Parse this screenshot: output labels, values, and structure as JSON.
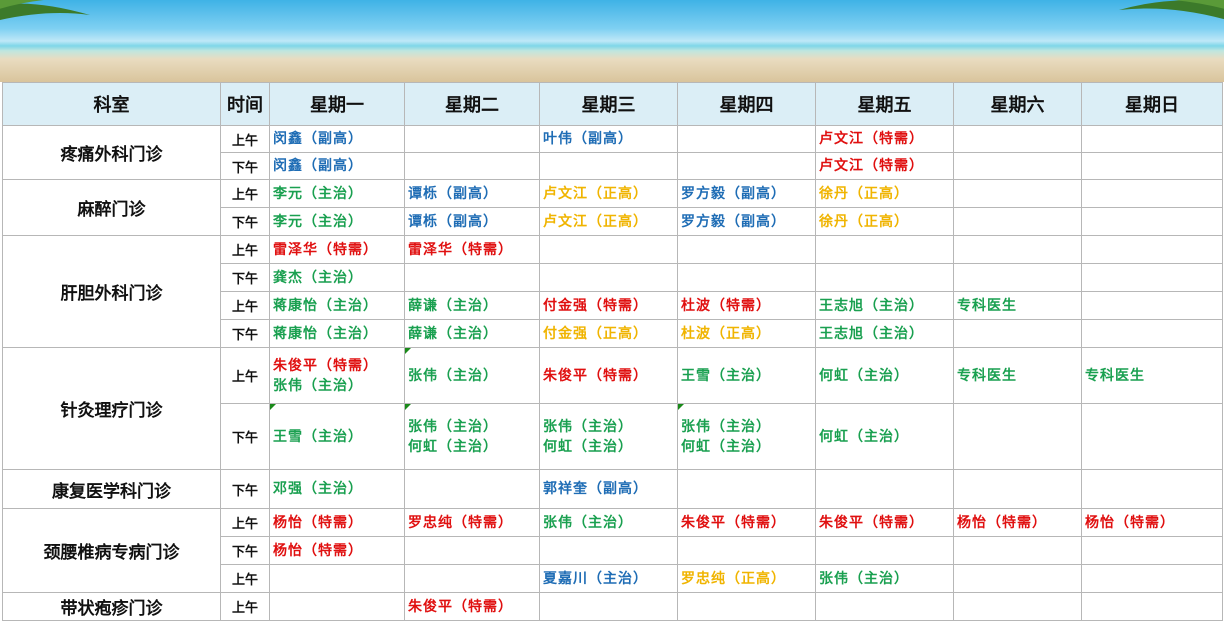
{
  "colors": {
    "blue": "#1f6db5",
    "red": "#e01010",
    "green": "#1aa050",
    "gold": "#f0b400",
    "header_bg": "#dbeef6"
  },
  "header": {
    "dept": "科室",
    "time": "时间",
    "days": [
      "星期一",
      "星期二",
      "星期三",
      "星期四",
      "星期五",
      "星期六",
      "星期日"
    ]
  },
  "rows": [
    {
      "dept": "疼痛外科门诊",
      "time": "上午",
      "cells": [
        {
          "lines": [
            {
              "t": "闵鑫（副高）",
              "c": "blue"
            }
          ]
        },
        {},
        {
          "lines": [
            {
              "t": "叶伟（副高）",
              "c": "blue"
            }
          ]
        },
        {},
        {
          "lines": [
            {
              "t": "卢文江（特需）",
              "c": "red"
            }
          ]
        },
        {},
        {}
      ]
    },
    {
      "time": "下午",
      "cells": [
        {
          "lines": [
            {
              "t": "闵鑫（副高）",
              "c": "blue"
            }
          ]
        },
        {},
        {},
        {},
        {
          "lines": [
            {
              "t": "卢文江（特需）",
              "c": "red"
            }
          ]
        },
        {},
        {}
      ]
    },
    {
      "dept": "麻醉门诊",
      "time": "上午",
      "cells": [
        {
          "lines": [
            {
              "t": "李元（主治）",
              "c": "green"
            }
          ]
        },
        {
          "lines": [
            {
              "t": "谭栎（副高）",
              "c": "blue"
            }
          ]
        },
        {
          "lines": [
            {
              "t": "卢文江（正高）",
              "c": "gold"
            }
          ]
        },
        {
          "lines": [
            {
              "t": "罗方毅（副高）",
              "c": "blue"
            }
          ]
        },
        {
          "lines": [
            {
              "t": "徐丹（正高）",
              "c": "gold"
            }
          ]
        },
        {},
        {}
      ]
    },
    {
      "time": "下午",
      "cells": [
        {
          "lines": [
            {
              "t": "李元（主治）",
              "c": "green"
            }
          ]
        },
        {
          "lines": [
            {
              "t": "谭栎（副高）",
              "c": "blue"
            }
          ]
        },
        {
          "lines": [
            {
              "t": "卢文江（正高）",
              "c": "gold"
            }
          ]
        },
        {
          "lines": [
            {
              "t": "罗方毅（副高）",
              "c": "blue"
            }
          ]
        },
        {
          "lines": [
            {
              "t": "徐丹（正高）",
              "c": "gold"
            }
          ]
        },
        {},
        {}
      ]
    },
    {
      "dept": "肝胆外科门诊",
      "time": "上午",
      "cells": [
        {
          "lines": [
            {
              "t": "雷泽华（特需）",
              "c": "red"
            }
          ]
        },
        {
          "lines": [
            {
              "t": "雷泽华（特需）",
              "c": "red"
            }
          ]
        },
        {},
        {},
        {},
        {},
        {}
      ]
    },
    {
      "time": "下午",
      "cells": [
        {
          "lines": [
            {
              "t": "龚杰（主治）",
              "c": "green"
            }
          ]
        },
        {},
        {},
        {},
        {},
        {},
        {}
      ]
    },
    {
      "time": "上午",
      "cells": [
        {
          "lines": [
            {
              "t": "蒋康怡（主治）",
              "c": "green"
            }
          ]
        },
        {
          "lines": [
            {
              "t": "薛谦（主治）",
              "c": "green"
            }
          ]
        },
        {
          "lines": [
            {
              "t": "付金强（特需）",
              "c": "red"
            }
          ]
        },
        {
          "lines": [
            {
              "t": "杜波（特需）",
              "c": "red"
            }
          ]
        },
        {
          "lines": [
            {
              "t": "王志旭（主治）",
              "c": "green"
            }
          ]
        },
        {
          "lines": [
            {
              "t": "专科医生",
              "c": "green"
            }
          ]
        },
        {}
      ]
    },
    {
      "time": "下午",
      "cells": [
        {
          "lines": [
            {
              "t": "蒋康怡（主治）",
              "c": "green"
            }
          ]
        },
        {
          "lines": [
            {
              "t": "薛谦（主治）",
              "c": "green"
            }
          ]
        },
        {
          "lines": [
            {
              "t": "付金强（正高）",
              "c": "gold"
            }
          ]
        },
        {
          "lines": [
            {
              "t": "杜波（正高）",
              "c": "gold"
            }
          ]
        },
        {
          "lines": [
            {
              "t": "王志旭（主治）",
              "c": "green"
            }
          ]
        },
        {},
        {}
      ]
    },
    {
      "dept": "针灸理疗门诊",
      "time": "上午",
      "cells": [
        {
          "lines": [
            {
              "t": "朱俊平（特需）",
              "c": "red"
            },
            {
              "t": "张伟（主治）",
              "c": "green"
            }
          ]
        },
        {
          "lines": [
            {
              "t": "张伟（主治）",
              "c": "green"
            }
          ],
          "mark": true
        },
        {
          "lines": [
            {
              "t": "朱俊平（特需）",
              "c": "red"
            }
          ]
        },
        {
          "lines": [
            {
              "t": "王雪（主治）",
              "c": "green"
            }
          ]
        },
        {
          "lines": [
            {
              "t": "何虹（主治）",
              "c": "green"
            }
          ]
        },
        {
          "lines": [
            {
              "t": "专科医生",
              "c": "green"
            }
          ]
        },
        {
          "lines": [
            {
              "t": "专科医生",
              "c": "green"
            }
          ]
        }
      ]
    },
    {
      "time": "下午",
      "cells": [
        {
          "lines": [
            {
              "t": "王雪（主治）",
              "c": "green"
            }
          ],
          "mark": true
        },
        {
          "lines": [
            {
              "t": "张伟（主治）",
              "c": "green"
            },
            {
              "t": "何虹（主治）",
              "c": "green"
            }
          ],
          "mark": true
        },
        {
          "lines": [
            {
              "t": "张伟（主治）",
              "c": "green"
            },
            {
              "t": "何虹（主治）",
              "c": "green"
            }
          ]
        },
        {
          "lines": [
            {
              "t": "张伟（主治）",
              "c": "green"
            },
            {
              "t": "何虹（主治）",
              "c": "green"
            }
          ],
          "mark": true
        },
        {
          "lines": [
            {
              "t": "何虹（主治）",
              "c": "green"
            }
          ]
        },
        {},
        {}
      ]
    },
    {
      "dept": "康复医学科门诊",
      "time": "下午",
      "cells": [
        {
          "lines": [
            {
              "t": "邓强（主治）",
              "c": "green"
            }
          ]
        },
        {},
        {
          "lines": [
            {
              "t": "郭祥奎（副高）",
              "c": "blue"
            }
          ]
        },
        {},
        {},
        {},
        {}
      ]
    },
    {
      "dept": "颈腰椎病专病门诊",
      "time": "上午",
      "cells": [
        {
          "lines": [
            {
              "t": "杨怡（特需）",
              "c": "red"
            }
          ]
        },
        {
          "lines": [
            {
              "t": "罗忠纯（特需）",
              "c": "red"
            }
          ]
        },
        {
          "lines": [
            {
              "t": "张伟（主治）",
              "c": "green"
            }
          ]
        },
        {
          "lines": [
            {
              "t": "朱俊平（特需）",
              "c": "red"
            }
          ]
        },
        {
          "lines": [
            {
              "t": "朱俊平（特需）",
              "c": "red"
            }
          ]
        },
        {
          "lines": [
            {
              "t": "杨怡（特需）",
              "c": "red"
            }
          ]
        },
        {
          "lines": [
            {
              "t": "杨怡（特需）",
              "c": "red"
            }
          ]
        }
      ]
    },
    {
      "time": "下午",
      "cells": [
        {
          "lines": [
            {
              "t": "杨怡（特需）",
              "c": "red"
            }
          ]
        },
        {},
        {},
        {},
        {},
        {},
        {}
      ]
    },
    {
      "time": "上午",
      "cells": [
        {},
        {},
        {
          "lines": [
            {
              "t": "夏嘉川（主治）",
              "c": "blue"
            }
          ]
        },
        {
          "lines": [
            {
              "t": "罗忠纯（正高）",
              "c": "gold"
            }
          ]
        },
        {
          "lines": [
            {
              "t": "张伟（主治）",
              "c": "green"
            }
          ]
        },
        {},
        {}
      ]
    },
    {
      "dept": "带状疱疹门诊",
      "time": "上午",
      "cells": [
        {},
        {
          "lines": [
            {
              "t": "朱俊平（特需）",
              "c": "red"
            }
          ]
        },
        {},
        {},
        {},
        {},
        {}
      ]
    }
  ]
}
